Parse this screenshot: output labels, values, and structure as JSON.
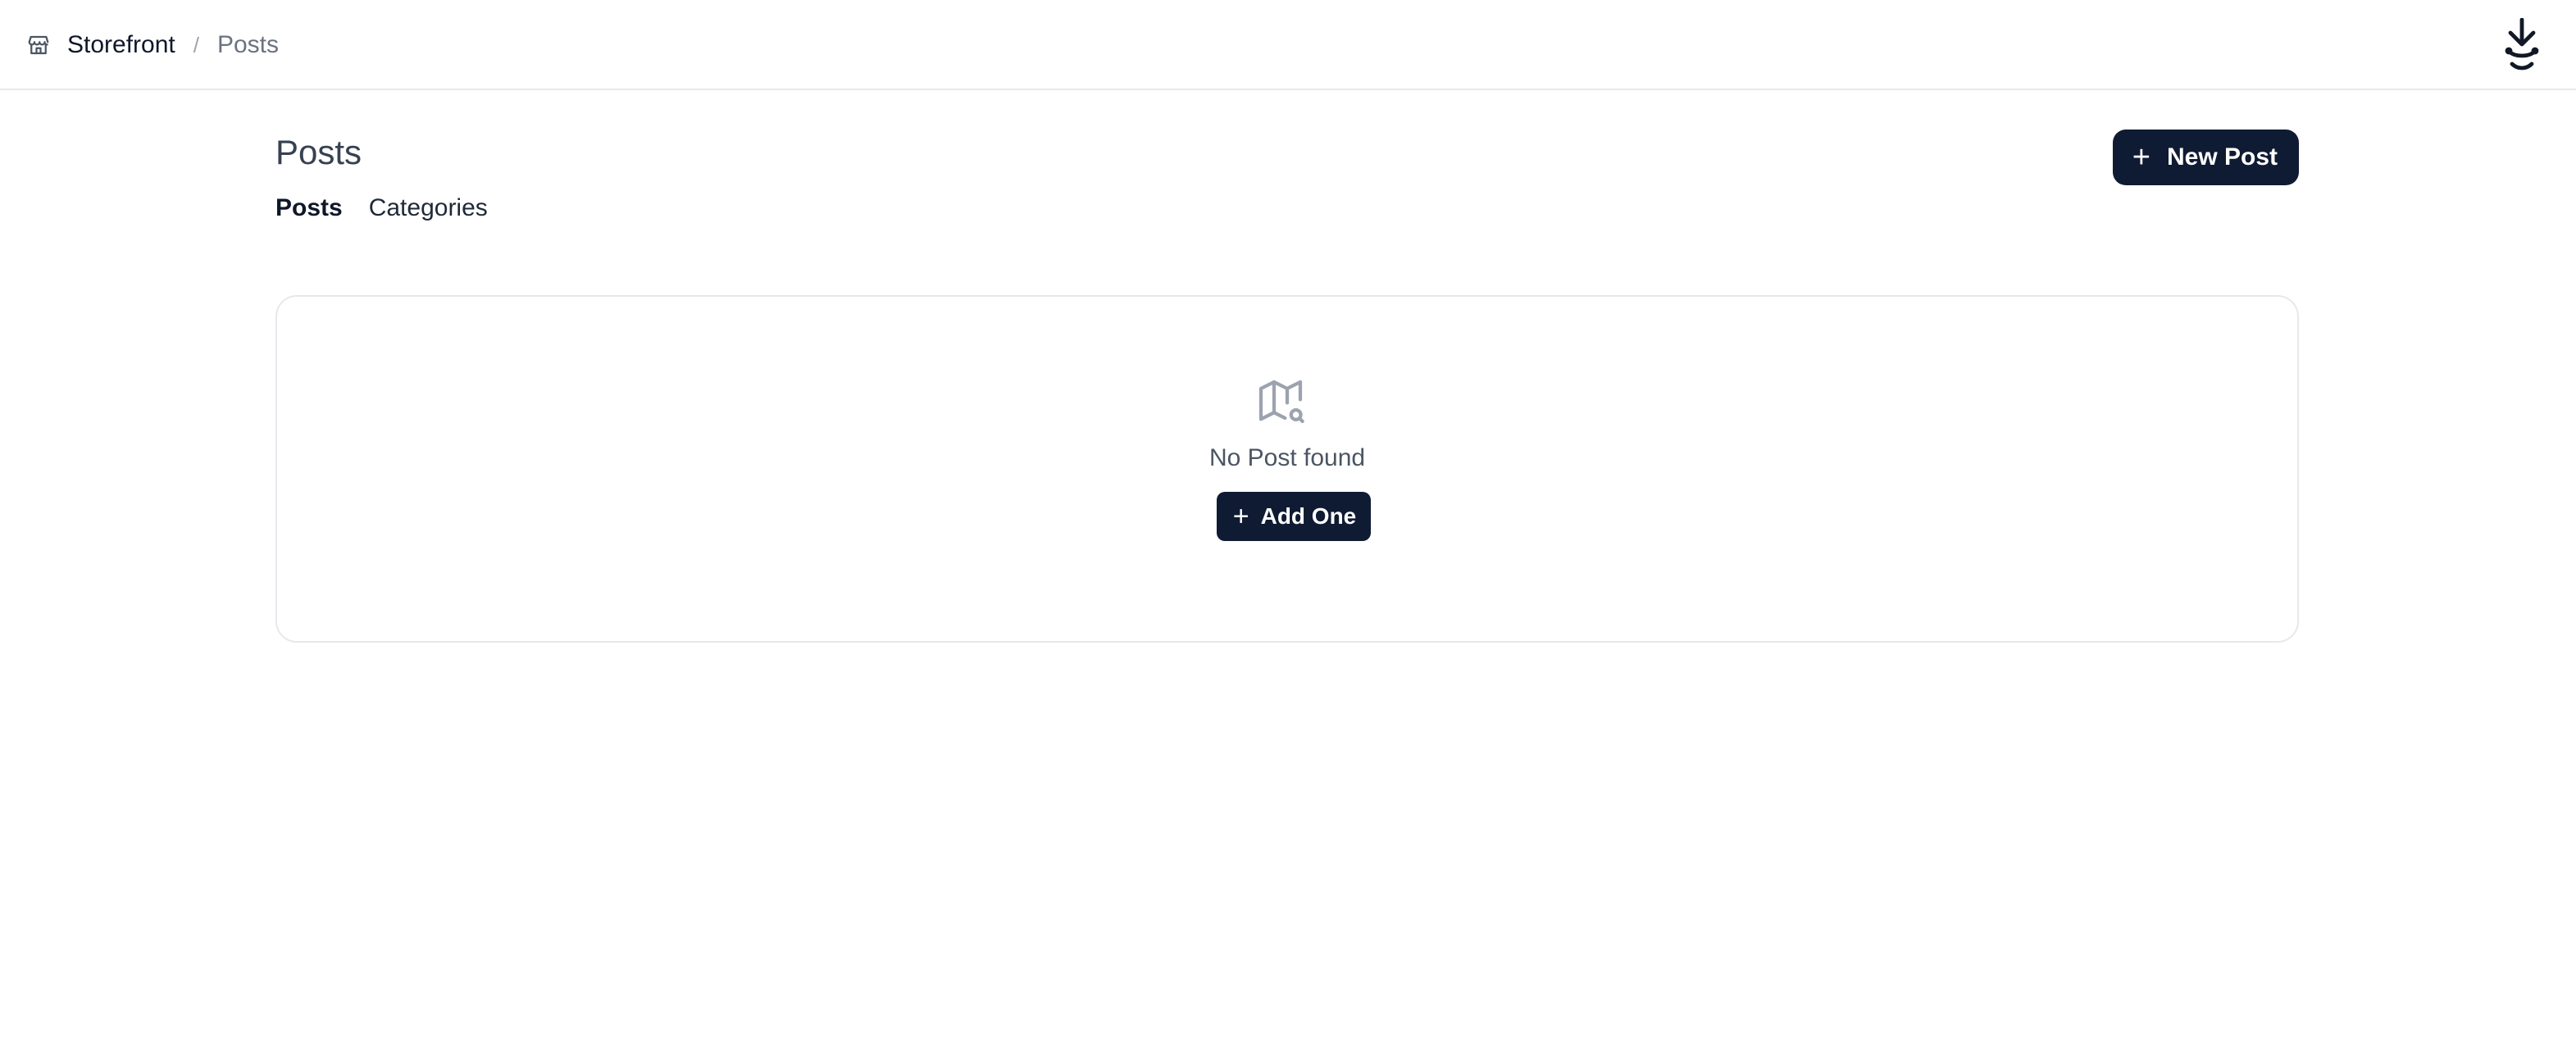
{
  "breadcrumb": {
    "store": "Storefront",
    "separator": "/",
    "current": "Posts"
  },
  "header": {
    "title": "Posts",
    "new_post_label": "New Post"
  },
  "tabs": [
    {
      "label": "Posts",
      "active": true
    },
    {
      "label": "Categories",
      "active": false
    }
  ],
  "empty_state": {
    "message": "No Post found",
    "add_label": "Add One"
  },
  "icons": {
    "store": "store-icon",
    "logo": "app-logo",
    "empty": "map-search-icon",
    "plus": "plus-icon"
  },
  "colors": {
    "primary": "#0f1b33",
    "border": "#e6e8ec"
  }
}
